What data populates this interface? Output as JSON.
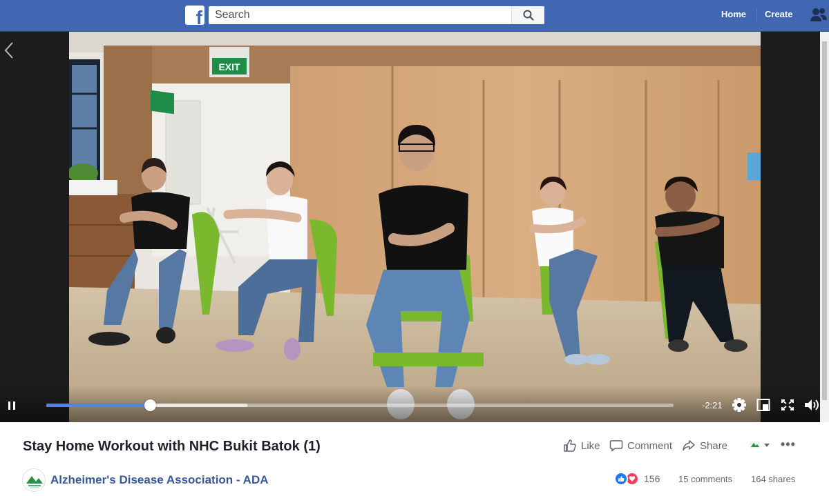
{
  "topbar": {
    "logo_letter": "f",
    "search_placeholder": "Search",
    "nav": {
      "home": "Home",
      "create": "Create"
    }
  },
  "player": {
    "progress_fraction": 0.165,
    "buffered_fraction": 0.32,
    "time_remaining": "-2:21"
  },
  "video": {
    "exit_sign_text": "EXIT",
    "title": "Stay Home Workout with NHC Bukit Batok (1)",
    "page_name": "Alzheimer's Disease Association - ADA"
  },
  "actions": {
    "like": "Like",
    "comment": "Comment",
    "share": "Share"
  },
  "stats": {
    "reactions_count": "156",
    "comments": "15 comments",
    "shares": "164 shares"
  },
  "colors": {
    "brand_blue": "#4267b2",
    "progress_blue": "#4d84f0",
    "link_blue": "#385898",
    "like_blue": "#2078f4",
    "love_red": "#f33e58"
  },
  "icons": [
    "facebook-logo",
    "search-icon",
    "friends-icon",
    "chevron-left-icon",
    "pause-icon",
    "gear-icon",
    "miniplayer-icon",
    "fullscreen-icon",
    "volume-icon",
    "like-icon",
    "comment-icon",
    "share-icon",
    "caret-down-icon",
    "more-icon"
  ]
}
